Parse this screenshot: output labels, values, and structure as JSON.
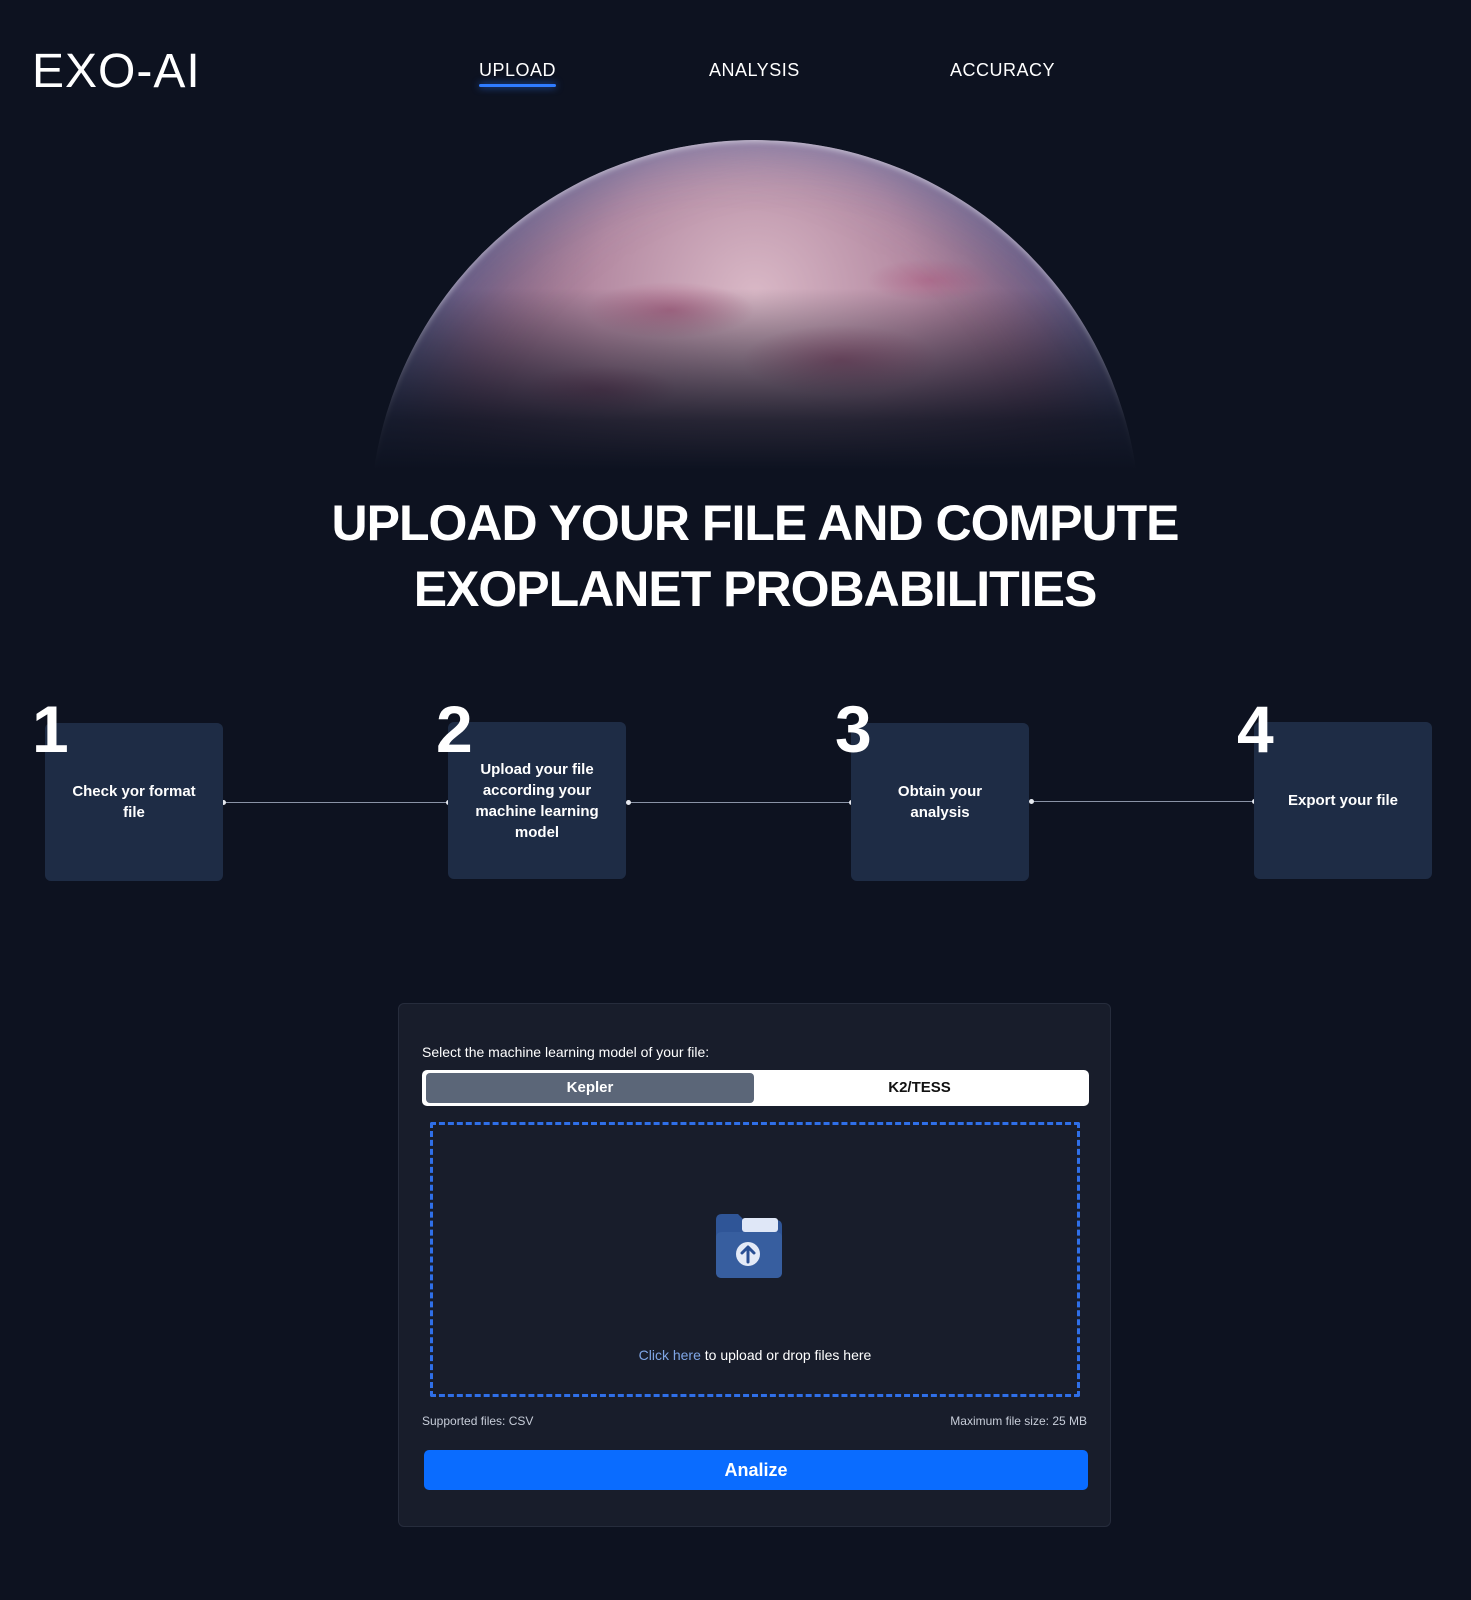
{
  "header": {
    "logo": "EXO-AI",
    "nav": [
      {
        "label": "UPLOAD",
        "active": true
      },
      {
        "label": "ANALYSIS",
        "active": false
      },
      {
        "label": "ACCURACY",
        "active": false
      }
    ]
  },
  "hero": {
    "headline_line1": "UPLOAD YOUR FILE AND COMPUTE",
    "headline_line2": "EXOPLANET PROBABILITIES"
  },
  "steps": [
    {
      "number": "1",
      "label": "Check yor format file"
    },
    {
      "number": "2",
      "label": "Upload your file according your machine learning model"
    },
    {
      "number": "3",
      "label": "Obtain your analysis"
    },
    {
      "number": "4",
      "label": "Export your file"
    }
  ],
  "upload": {
    "model_label": "Select the machine learning model of your file:",
    "models": [
      {
        "label": "Kepler",
        "selected": true
      },
      {
        "label": "K2/TESS",
        "selected": false
      }
    ],
    "drop_link": "Click here",
    "drop_text": " to upload or drop files here",
    "supported": "Supported files: CSV",
    "max_size": "Maximum file size: 25 MB",
    "button_label": "Analize"
  },
  "colors": {
    "background": "#0d1220",
    "accent": "#0a6cff",
    "card": "#1e2c45",
    "dropzone_border": "#2f6fe8"
  },
  "icons": [
    "folder-upload-icon"
  ]
}
